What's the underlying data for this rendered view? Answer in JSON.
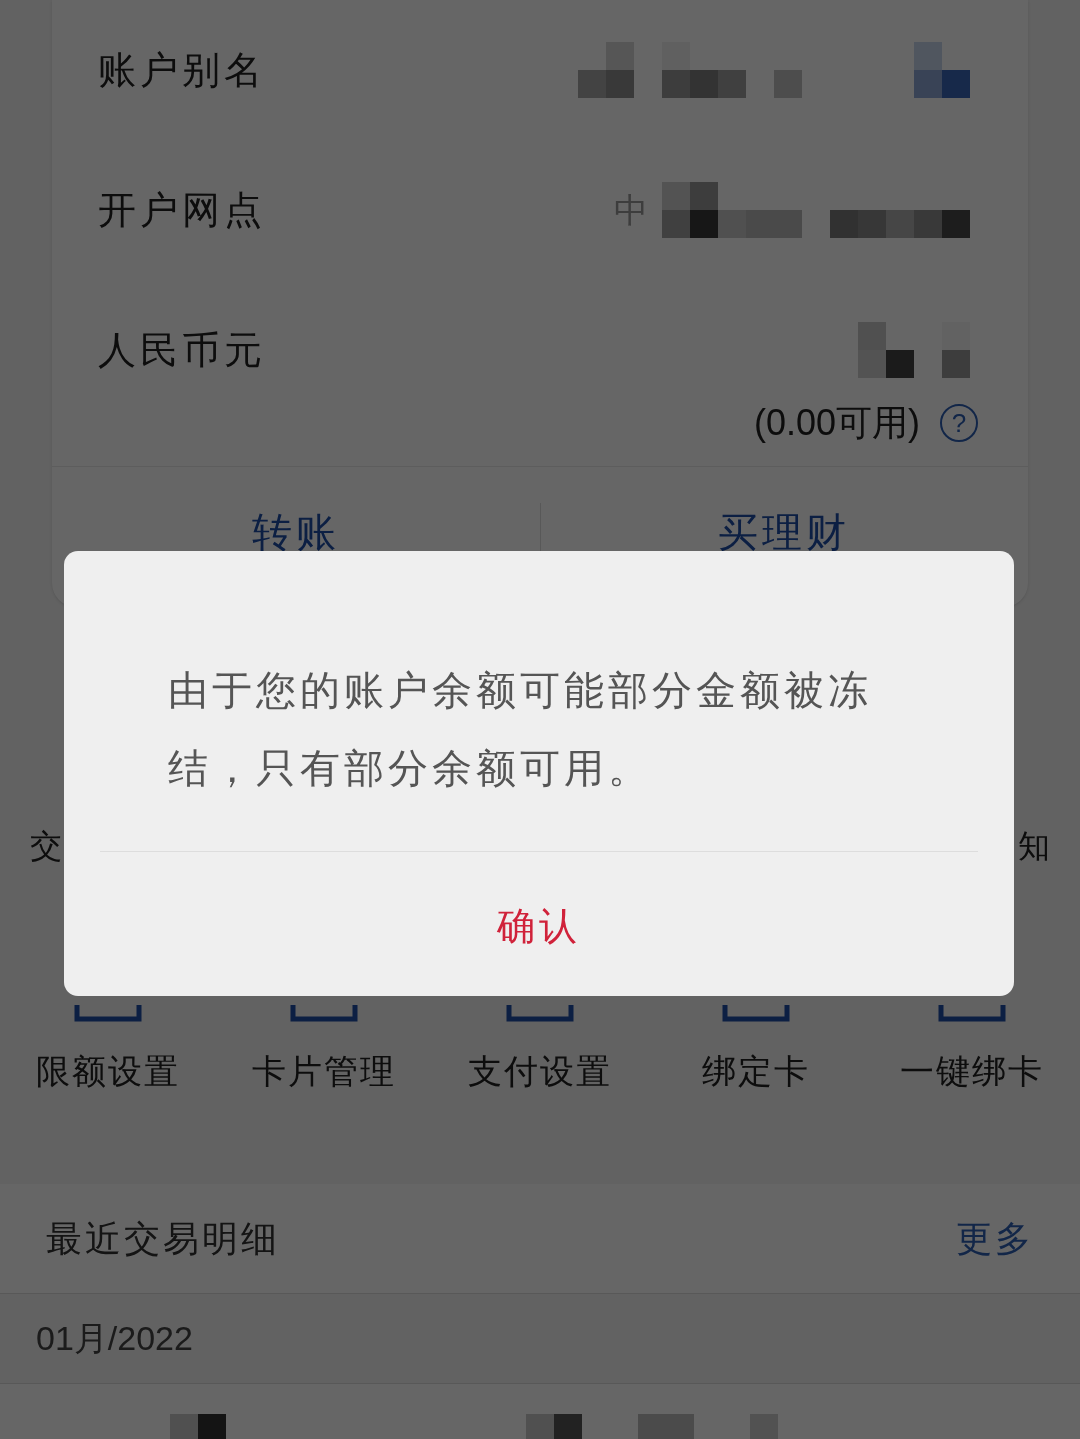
{
  "account_card": {
    "rows": [
      {
        "label": "账户别名",
        "prefix": "",
        "kind": "redacted"
      },
      {
        "label": "开户网点",
        "prefix": "中",
        "kind": "redacted"
      },
      {
        "label": "人民币元",
        "prefix": "",
        "kind": "redacted"
      }
    ],
    "available": "(0.00可用)",
    "help_icon": "?",
    "actions": [
      "转账",
      "买理财"
    ]
  },
  "shortcuts_partial": [
    "交",
    "知"
  ],
  "shortcuts": [
    {
      "label": "限额设置"
    },
    {
      "label": "卡片管理"
    },
    {
      "label": "支付设置"
    },
    {
      "label": "绑定卡"
    },
    {
      "label": "一键绑卡"
    }
  ],
  "recent": {
    "title": "最近交易明细",
    "more": "更多",
    "month": "01月/2022"
  },
  "dialog": {
    "message": "由于您的账户余额可能部分金额被冻结，只有部分余额可用。",
    "confirm": "确认"
  }
}
